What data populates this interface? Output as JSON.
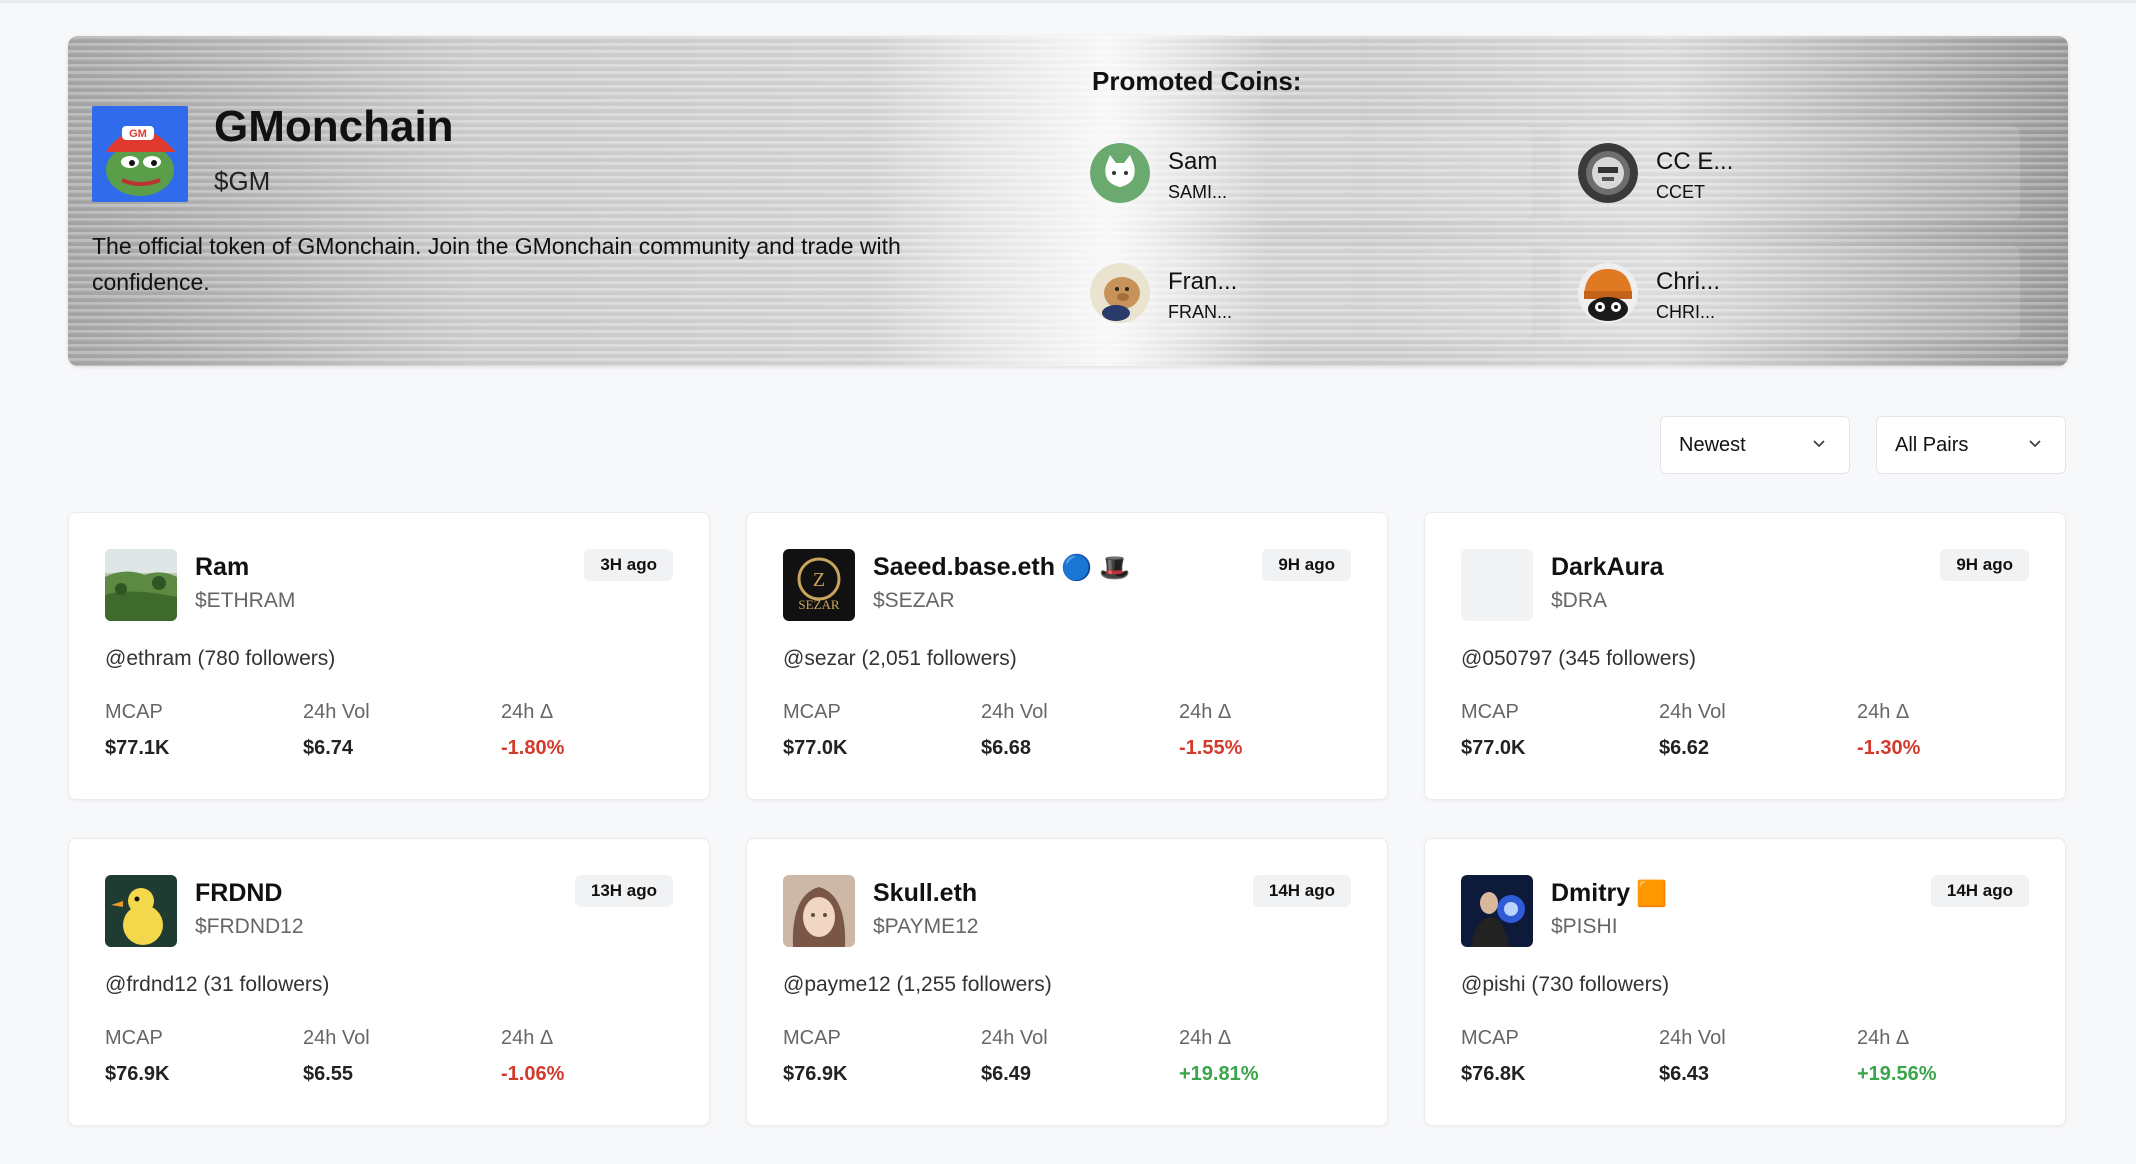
{
  "hero": {
    "name": "GMonchain",
    "ticker": "$GM",
    "description": "The official token of GMonchain. Join the GMonchain community and trade with confidence.",
    "logo_text": "GM",
    "promoted_title": "Promoted Coins:",
    "promoted": [
      {
        "name": "Sam",
        "symbol": "SAMI...",
        "icon": "cat-avatar-icon"
      },
      {
        "name": "CC E...",
        "symbol": "CCET",
        "icon": "mask-avatar-icon"
      },
      {
        "name": "Fran...",
        "symbol": "FRAN...",
        "icon": "capybara-avatar-icon"
      },
      {
        "name": "Chri...",
        "symbol": "CHRI...",
        "icon": "beanie-avatar-icon"
      }
    ]
  },
  "filters": {
    "sort": "Newest",
    "pairs": "All Pairs"
  },
  "labels": {
    "mcap": "MCAP",
    "vol": "24h Vol",
    "delta": "24h Δ"
  },
  "cards": [
    {
      "name": "Ram",
      "ticker": "$ETHRAM",
      "age": "3H ago",
      "handle": "@ethram (780 followers)",
      "mcap": "$77.1K",
      "vol": "$6.74",
      "delta": "-1.80%",
      "trend": "neg",
      "badges": ""
    },
    {
      "name": "Saeed.base.eth",
      "ticker": "$SEZAR",
      "age": "9H ago",
      "handle": "@sezar (2,051 followers)",
      "mcap": "$77.0K",
      "vol": "$6.68",
      "delta": "-1.55%",
      "trend": "neg",
      "badges": "🔵 🎩",
      "logo_text": "SEZAR"
    },
    {
      "name": "DarkAura",
      "ticker": "$DRA",
      "age": "9H ago",
      "handle": "@050797 (345 followers)",
      "mcap": "$77.0K",
      "vol": "$6.62",
      "delta": "-1.30%",
      "trend": "neg",
      "badges": ""
    },
    {
      "name": "FRDND",
      "ticker": "$FRDND12",
      "age": "13H ago",
      "handle": "@frdnd12 (31 followers)",
      "mcap": "$76.9K",
      "vol": "$6.55",
      "delta": "-1.06%",
      "trend": "neg",
      "badges": ""
    },
    {
      "name": "Skull.eth",
      "ticker": "$PAYME12",
      "age": "14H ago",
      "handle": "@payme12 (1,255 followers)",
      "mcap": "$76.9K",
      "vol": "$6.49",
      "delta": "+19.81%",
      "trend": "pos",
      "badges": ""
    },
    {
      "name": "Dmitry",
      "ticker": "$PISHI",
      "age": "14H ago",
      "handle": "@pishi (730 followers)",
      "mcap": "$76.8K",
      "vol": "$6.43",
      "delta": "+19.56%",
      "trend": "pos",
      "badges": "🟧"
    }
  ],
  "colors": {
    "negative": "#d33a2c",
    "positive": "#3aa54a",
    "logo_blue": "#2f6bea"
  }
}
